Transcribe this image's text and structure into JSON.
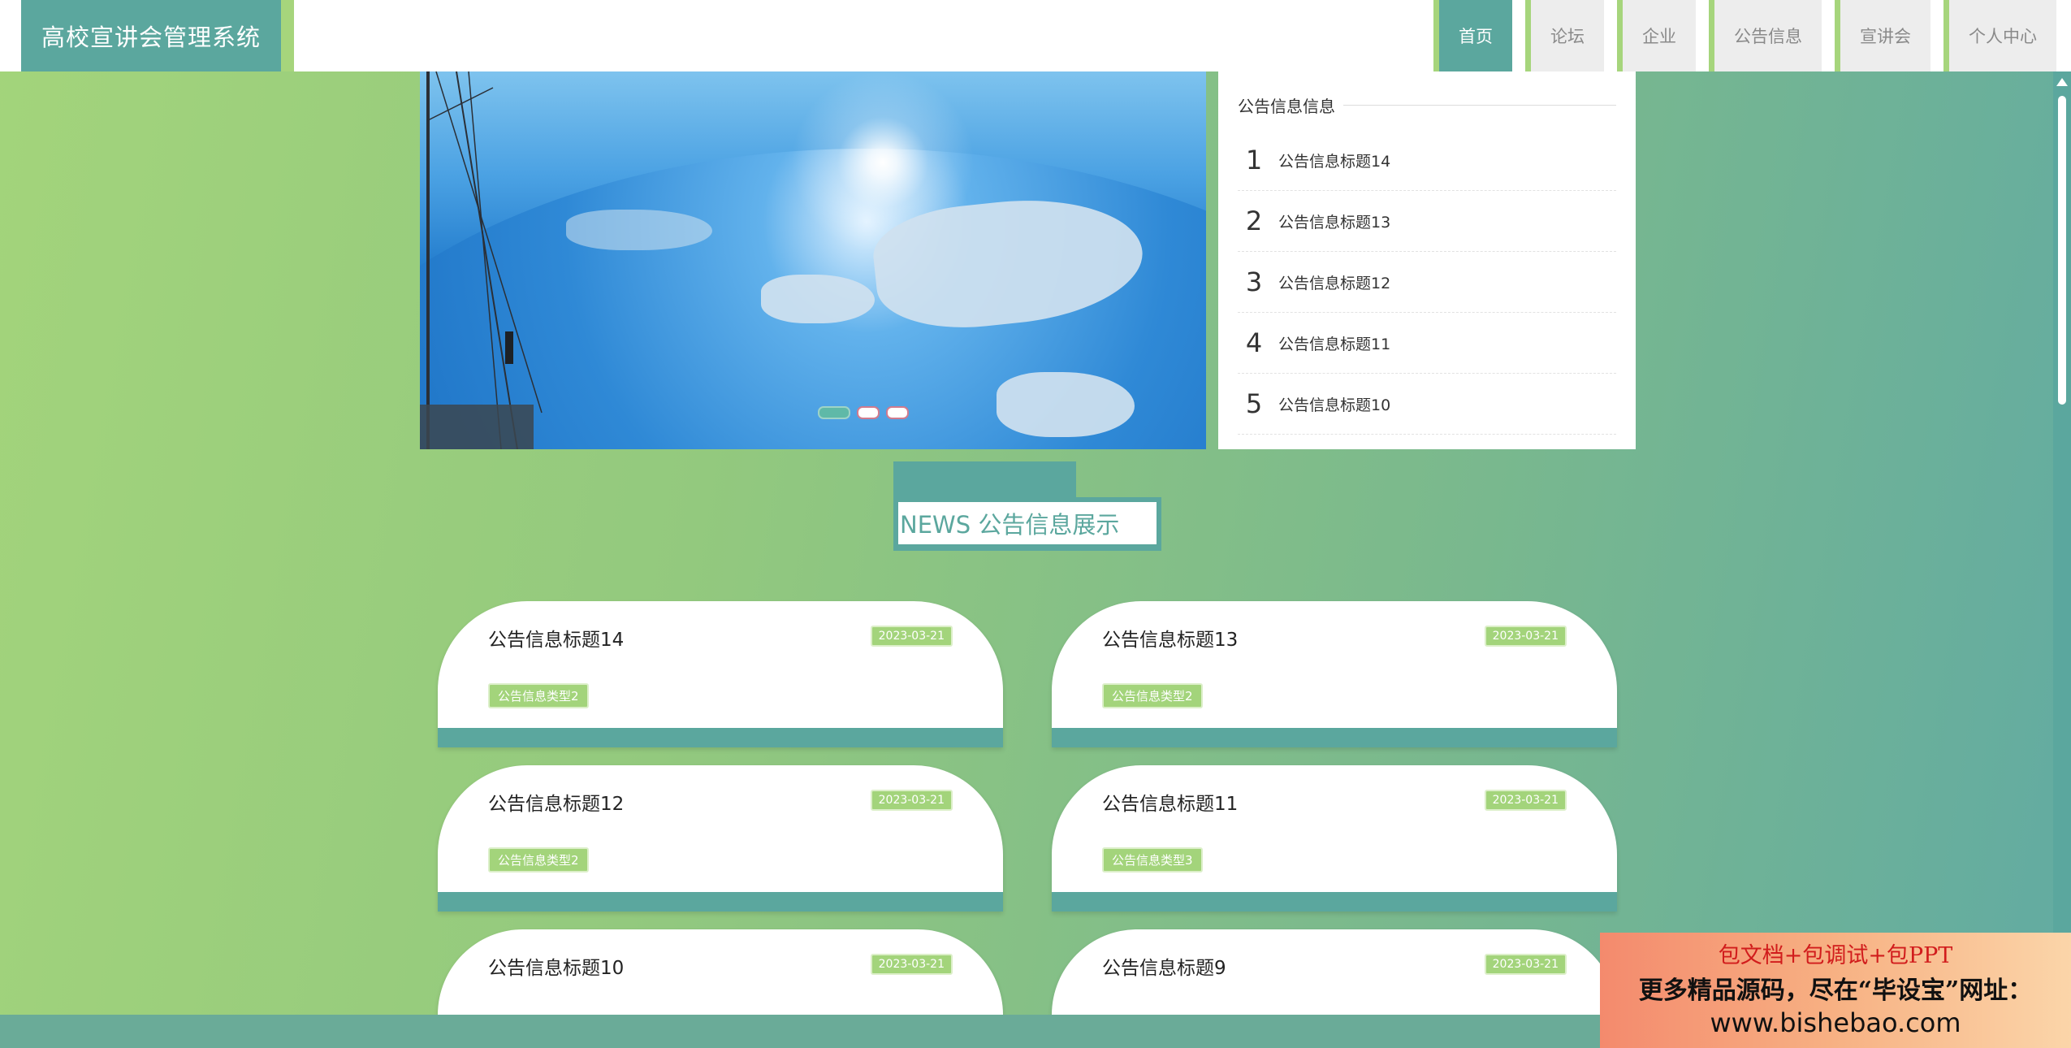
{
  "app": {
    "title": "高校宣讲会管理系统"
  },
  "nav": {
    "items": [
      {
        "label": "首页",
        "active": true
      },
      {
        "label": "论坛",
        "active": false
      },
      {
        "label": "企业",
        "active": false
      },
      {
        "label": "公告信息",
        "active": false
      },
      {
        "label": "宣讲会",
        "active": false
      },
      {
        "label": "个人中心",
        "active": false
      }
    ]
  },
  "banner": {
    "slide_count": 3,
    "active_slide": 1
  },
  "notice_panel": {
    "title": "公告信息信息",
    "items": [
      {
        "num": "1",
        "title": "公告信息标题14"
      },
      {
        "num": "2",
        "title": "公告信息标题13"
      },
      {
        "num": "3",
        "title": "公告信息标题12"
      },
      {
        "num": "4",
        "title": "公告信息标题11"
      },
      {
        "num": "5",
        "title": "公告信息标题10"
      }
    ]
  },
  "section": {
    "heading": "NEWS 公告信息展示"
  },
  "cards": [
    {
      "title": "公告信息标题14",
      "date": "2023-03-21",
      "type": "公告信息类型2"
    },
    {
      "title": "公告信息标题13",
      "date": "2023-03-21",
      "type": "公告信息类型2"
    },
    {
      "title": "公告信息标题12",
      "date": "2023-03-21",
      "type": "公告信息类型2"
    },
    {
      "title": "公告信息标题11",
      "date": "2023-03-21",
      "type": "公告信息类型3"
    },
    {
      "title": "公告信息标题10",
      "date": "2023-03-21",
      "type": ""
    },
    {
      "title": "公告信息标题9",
      "date": "2023-03-21",
      "type": ""
    }
  ],
  "ad": {
    "line1": "包文档+包调试+包PPT",
    "line2": "更多精品源码，尽在“毕设宝”网址：",
    "line3": "www.bishebao.com"
  },
  "colors": {
    "primary": "#5ba79e",
    "accent": "#a3d47b",
    "nav_inactive_bg": "#ededed"
  }
}
